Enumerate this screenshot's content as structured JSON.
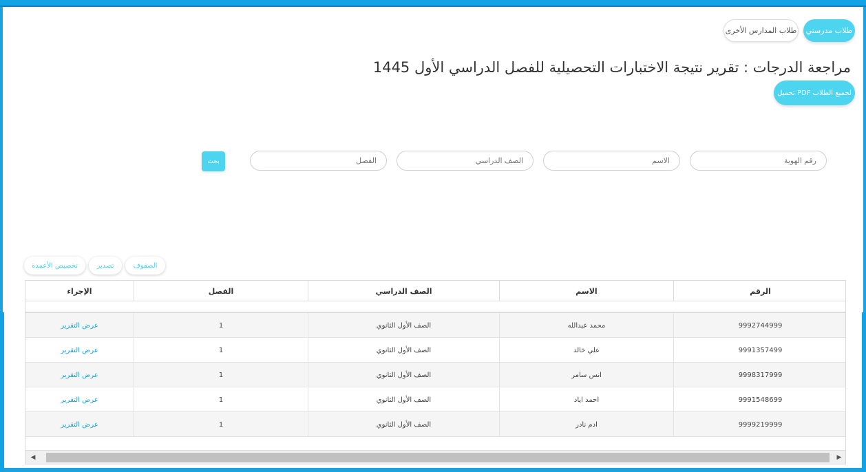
{
  "tabs": {
    "my_students": "طلاب مدرستي",
    "other_students": "طلاب المدارس الأخرى"
  },
  "page": {
    "title": "مراجعة الدرجات : تقرير نتيجة الاختبارات التحصيلية للفصل الدراسي الأول 1445",
    "download_pdf": "تحميل PDF لجميع الطلاب"
  },
  "search": {
    "id_placeholder": "رقم الهوية",
    "name_placeholder": "الاسم",
    "grade_placeholder": "الصف الدراسي",
    "class_placeholder": "الفصل",
    "button": "بحث"
  },
  "toolbar": {
    "rows": "الصفوف",
    "export": "تصدير",
    "customize_columns": "تخصيص الأعمدة"
  },
  "table": {
    "headers": {
      "id": "الرقم",
      "name": "الاسم",
      "grade": "الصف الدراسي",
      "class": "الفصل",
      "action": "الإجراء"
    },
    "rows": [
      {
        "id": "9992744999",
        "name": "محمد عبدالله",
        "grade": "الصف الأول الثانوي",
        "class": "1",
        "action": "عرض التقرير"
      },
      {
        "id": "9991357499",
        "name": "علي خالد",
        "grade": "الصف الأول الثانوي",
        "class": "1",
        "action": "عرض التقرير"
      },
      {
        "id": "9998317999",
        "name": "انس سامر",
        "grade": "الصف الأول الثانوي",
        "class": "1",
        "action": "عرض التقرير"
      },
      {
        "id": "9991548699",
        "name": "احمد اياد",
        "grade": "الصف الأول الثانوي",
        "class": "1",
        "action": "عرض التقرير"
      },
      {
        "id": "9999219999",
        "name": "ادم نادر",
        "grade": "الصف الأول الثانوي",
        "class": "1",
        "action": "عرض التقرير"
      }
    ]
  },
  "colors": {
    "accent": "#4dd4ee",
    "frame": "#12a2e6",
    "link": "#1aa3e0"
  }
}
